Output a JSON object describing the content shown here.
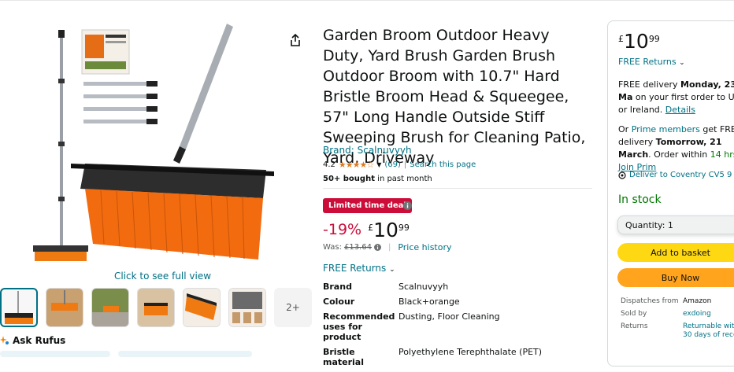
{
  "gallery": {
    "see_full": "Click to see full view",
    "more_thumbs": "2+",
    "ask_rufus": "Ask Rufus"
  },
  "product": {
    "title": "Garden Broom Outdoor Heavy Duty, Yard Brush Garden Brush Outdoor Broom with 10.7\" Hard Bristle Broom Head & Squeegee, 57\" Long Handle Outside Stiff Sweeping Brush for Cleaning Patio, Yard, Driveway",
    "brand_link": "Brand: Scalnuvyyh",
    "rating_value": "4.2",
    "stars": "★★★★☆",
    "rating_count": "(69)",
    "search_page": "Search this page",
    "bought_bold": "50+ bought",
    "bought_rest": " in past month",
    "deal_badge": "Limited time deal",
    "discount": "-19%",
    "currency": "£",
    "price_whole": "10",
    "price_fraction": "99",
    "was_label": "Was:",
    "was_price": "£13.64",
    "price_history": "Price history",
    "free_returns": "FREE Returns"
  },
  "specs": [
    {
      "key": "Brand",
      "value": "Scalnuvyyh"
    },
    {
      "key": "Colour",
      "value": "Black+orange"
    },
    {
      "key": "Recommended uses for product",
      "value": "Dusting, Floor Cleaning"
    },
    {
      "key": "Bristle material",
      "value": "Polyethylene Terephthalate (PET)"
    }
  ],
  "buybox": {
    "currency": "£",
    "price_whole": "10",
    "price_fraction": "99",
    "free_returns": "FREE Returns",
    "delivery_pre": "FREE delivery ",
    "delivery_date": "Monday, 23 Ma",
    "delivery_post": " on your first order to UK or Ireland. ",
    "details": "Details",
    "prime_pre": "Or ",
    "prime_link": "Prime members",
    "prime_mid": " get FREE delivery ",
    "prime_date": "Tomorrow, 21 March",
    "prime_order": ". Order within ",
    "prime_hrs": "14 hrs",
    "prime_join": "Join Prim",
    "deliver_to": "Deliver to Coventry CV5 9",
    "stock": "In stock",
    "quantity": "Quantity: 1",
    "add_to_basket": "Add to basket",
    "buy_now": "Buy Now",
    "rows": [
      {
        "key": "Dispatches from",
        "value": "Amazon"
      },
      {
        "key": "Sold by",
        "value": "exdoing"
      },
      {
        "key": "Returns",
        "value": "Returnable wit 30 days of rece"
      }
    ]
  },
  "colors": {
    "link": "#007185",
    "deal": "#cc0c39",
    "stars": "#de7921",
    "add_to_basket": "#ffd814",
    "buy_now": "#ffa41c",
    "in_stock": "#007600"
  }
}
